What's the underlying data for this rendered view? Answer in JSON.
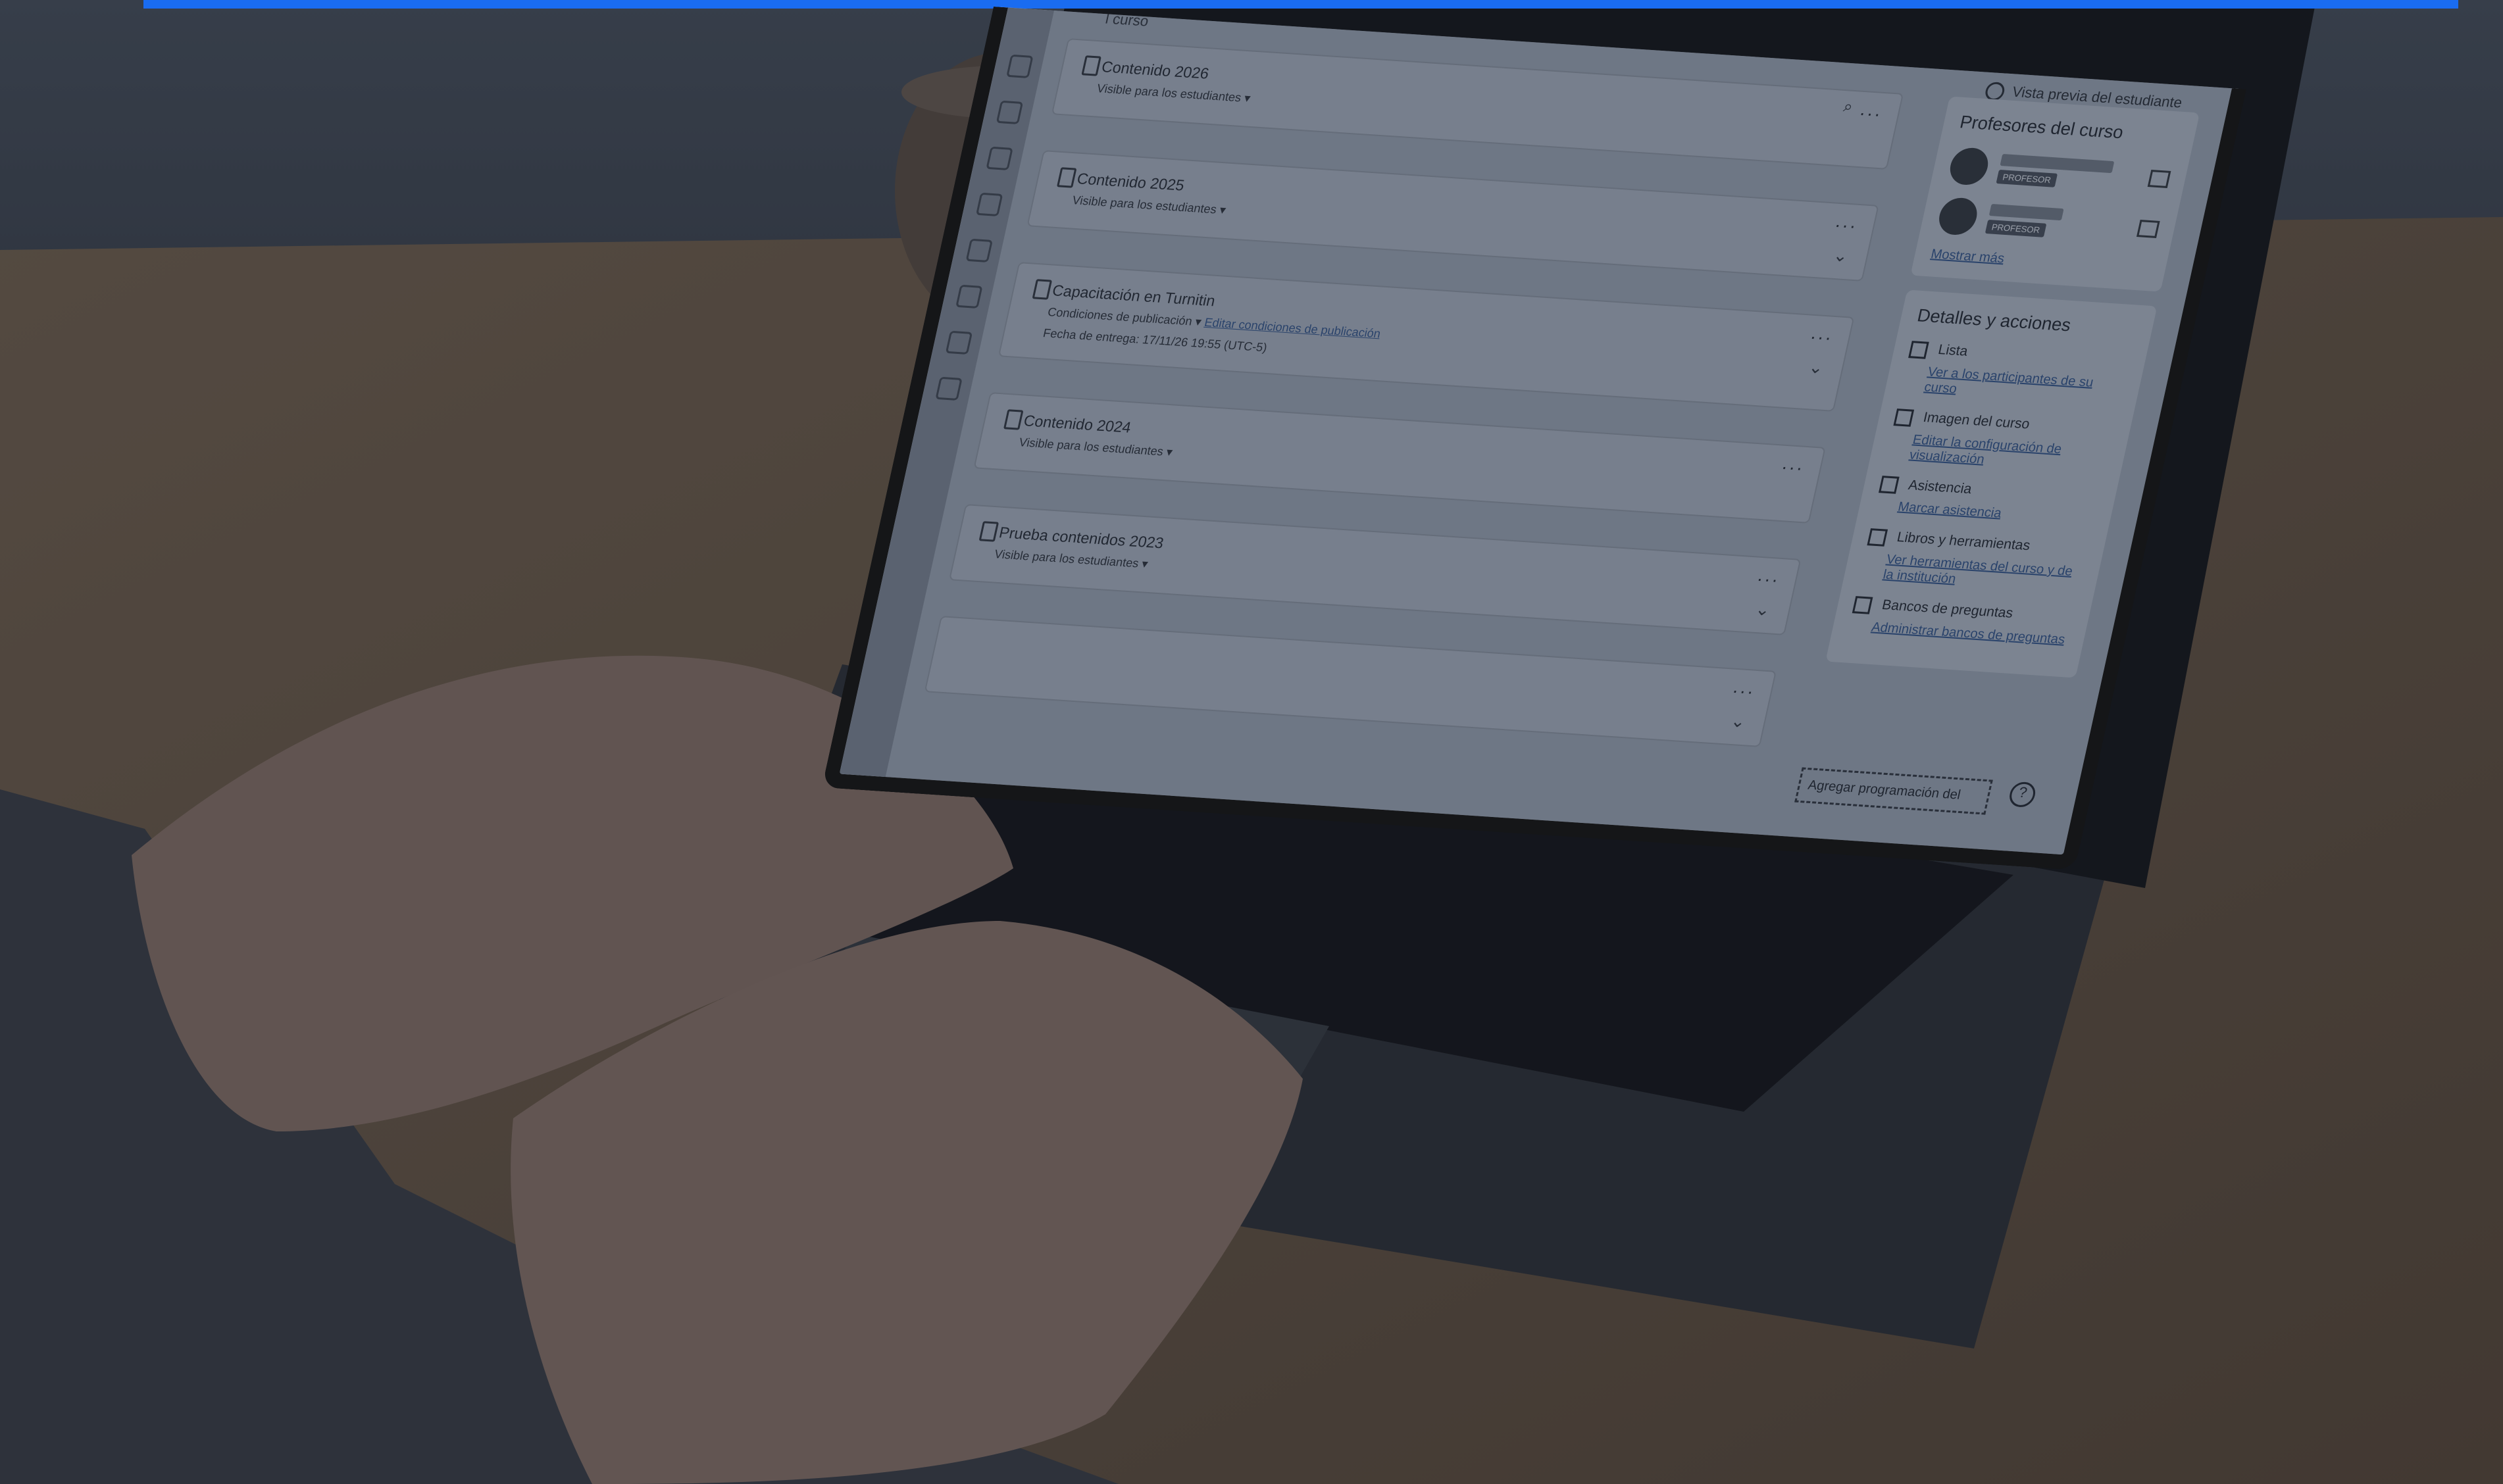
{
  "colors": {
    "top_bar": "#1a6cf0",
    "desk": "#7d6a52",
    "wall": "#4c535c",
    "laptop_body": "#2f3236",
    "keys": "#141517",
    "skin": "#8b7468"
  },
  "screen": {
    "course_title": "l curso",
    "student_preview": "Vista previa del estudiante",
    "modules": [
      {
        "name": "Contenido 2026",
        "status": "Visible para los estudiantes ▾"
      },
      {
        "name": "Contenido 2025",
        "status": "Visible para los estudiantes ▾"
      },
      {
        "name": "Capacitación en Turnitin",
        "status": "Condiciones de publicación ▾",
        "link": "Editar condiciones de publicación",
        "due": "Fecha de entrega: 17/11/26 19:55 (UTC-5)"
      },
      {
        "name": "Contenido 2024",
        "status": "Visible para los estudiantes ▾"
      },
      {
        "name": "Prueba contenidos 2023",
        "status": "Visible para los estudiantes ▾"
      }
    ],
    "teachers_card": {
      "title": "Profesores del curso",
      "role_label": "PROFESOR",
      "show_more": "Mostrar más"
    },
    "details_card": {
      "title": "Detalles y acciones",
      "actions": [
        {
          "label": "Lista",
          "link": "Ver a los participantes de su curso",
          "icon": "roster-icon"
        },
        {
          "label": "Imagen del curso",
          "link": "Editar la configuración de visualización",
          "icon": "image-icon"
        },
        {
          "label": "Asistencia",
          "link": "Marcar asistencia",
          "icon": "attendance-icon"
        },
        {
          "label": "Libros y herramientas",
          "link": "Ver herramientas del curso y de la institución",
          "icon": "tools-icon"
        },
        {
          "label": "Bancos de preguntas",
          "link": "Administrar bancos de preguntas",
          "icon": "question-bank-icon"
        }
      ]
    },
    "add_schedule": "Agregar programación del"
  }
}
